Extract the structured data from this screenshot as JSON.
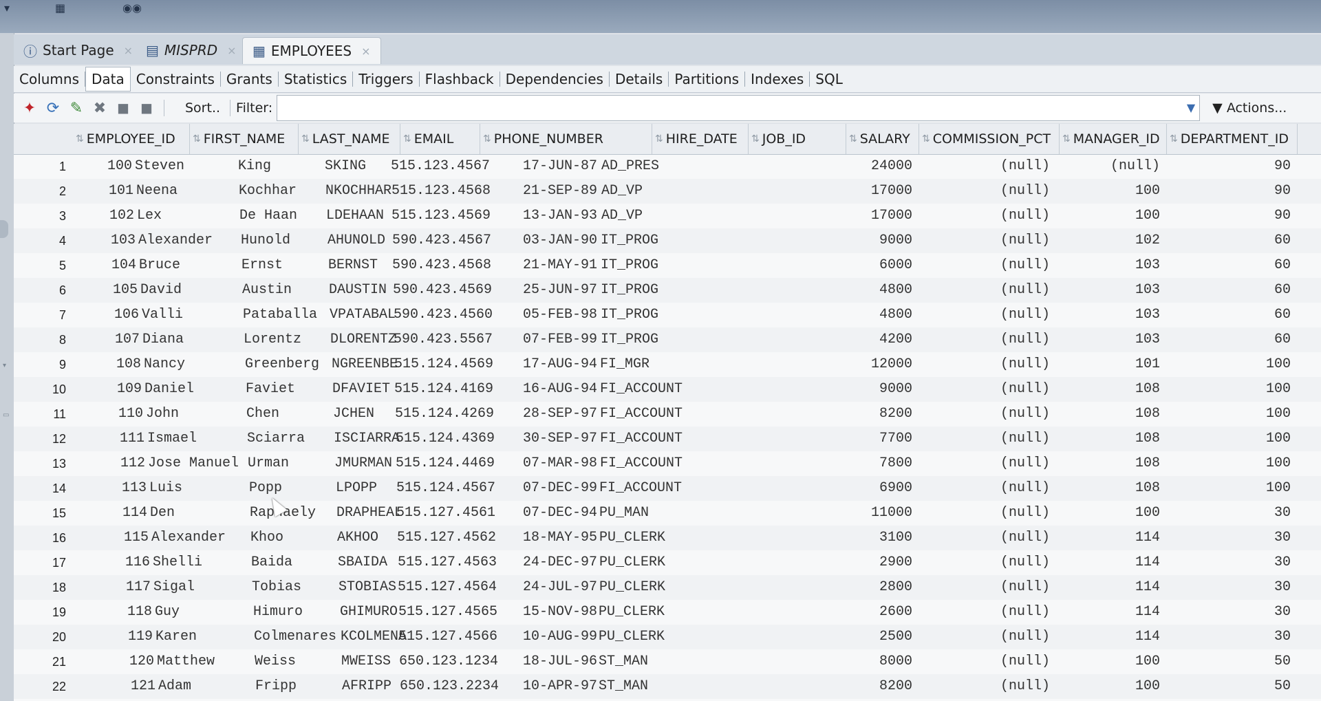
{
  "tabs": [
    {
      "icon": "help-icon",
      "label": "Start Page"
    },
    {
      "icon": "sql-connection-icon",
      "label": "MISPRD"
    },
    {
      "icon": "table-icon",
      "label": "EMPLOYEES"
    }
  ],
  "subtabs": [
    "Columns",
    "Data",
    "Constraints",
    "Grants",
    "Statistics",
    "Triggers",
    "Flashback",
    "Dependencies",
    "Details",
    "Partitions",
    "Indexes",
    "SQL"
  ],
  "toolbar": {
    "sort_label": "Sort..",
    "filter_label": "Filter:",
    "filter_value": "",
    "actions_label": "Actions..."
  },
  "columns": [
    "EMPLOYEE_ID",
    "FIRST_NAME",
    "LAST_NAME",
    "EMAIL",
    "PHONE_NUMBER",
    "HIRE_DATE",
    "JOB_ID",
    "SALARY",
    "COMMISSION_PCT",
    "MANAGER_ID",
    "DEPARTMENT_ID"
  ],
  "rows": [
    [
      "1",
      "100",
      "Steven",
      "King",
      "SKING",
      "515.123.4567",
      "17-JUN-87",
      "AD_PRES",
      "24000",
      "(null)",
      "(null)",
      "90"
    ],
    [
      "2",
      "101",
      "Neena",
      "Kochhar",
      "NKOCHHAR",
      "515.123.4568",
      "21-SEP-89",
      "AD_VP",
      "17000",
      "(null)",
      "100",
      "90"
    ],
    [
      "3",
      "102",
      "Lex",
      "De Haan",
      "LDEHAAN",
      "515.123.4569",
      "13-JAN-93",
      "AD_VP",
      "17000",
      "(null)",
      "100",
      "90"
    ],
    [
      "4",
      "103",
      "Alexander",
      "Hunold",
      "AHUNOLD",
      "590.423.4567",
      "03-JAN-90",
      "IT_PROG",
      "9000",
      "(null)",
      "102",
      "60"
    ],
    [
      "5",
      "104",
      "Bruce",
      "Ernst",
      "BERNST",
      "590.423.4568",
      "21-MAY-91",
      "IT_PROG",
      "6000",
      "(null)",
      "103",
      "60"
    ],
    [
      "6",
      "105",
      "David",
      "Austin",
      "DAUSTIN",
      "590.423.4569",
      "25-JUN-97",
      "IT_PROG",
      "4800",
      "(null)",
      "103",
      "60"
    ],
    [
      "7",
      "106",
      "Valli",
      "Pataballa",
      "VPATABAL",
      "590.423.4560",
      "05-FEB-98",
      "IT_PROG",
      "4800",
      "(null)",
      "103",
      "60"
    ],
    [
      "8",
      "107",
      "Diana",
      "Lorentz",
      "DLORENTZ",
      "590.423.5567",
      "07-FEB-99",
      "IT_PROG",
      "4200",
      "(null)",
      "103",
      "60"
    ],
    [
      "9",
      "108",
      "Nancy",
      "Greenberg",
      "NGREENBE",
      "515.124.4569",
      "17-AUG-94",
      "FI_MGR",
      "12000",
      "(null)",
      "101",
      "100"
    ],
    [
      "10",
      "109",
      "Daniel",
      "Faviet",
      "DFAVIET",
      "515.124.4169",
      "16-AUG-94",
      "FI_ACCOUNT",
      "9000",
      "(null)",
      "108",
      "100"
    ],
    [
      "11",
      "110",
      "John",
      "Chen",
      "JCHEN",
      "515.124.4269",
      "28-SEP-97",
      "FI_ACCOUNT",
      "8200",
      "(null)",
      "108",
      "100"
    ],
    [
      "12",
      "111",
      "Ismael",
      "Sciarra",
      "ISCIARRA",
      "515.124.4369",
      "30-SEP-97",
      "FI_ACCOUNT",
      "7700",
      "(null)",
      "108",
      "100"
    ],
    [
      "13",
      "112",
      "Jose Manuel",
      "Urman",
      "JMURMAN",
      "515.124.4469",
      "07-MAR-98",
      "FI_ACCOUNT",
      "7800",
      "(null)",
      "108",
      "100"
    ],
    [
      "14",
      "113",
      "Luis",
      "Popp",
      "LPOPP",
      "515.124.4567",
      "07-DEC-99",
      "FI_ACCOUNT",
      "6900",
      "(null)",
      "108",
      "100"
    ],
    [
      "15",
      "114",
      "Den",
      "Raphaely",
      "DRAPHEAL",
      "515.127.4561",
      "07-DEC-94",
      "PU_MAN",
      "11000",
      "(null)",
      "100",
      "30"
    ],
    [
      "16",
      "115",
      "Alexander",
      "Khoo",
      "AKHOO",
      "515.127.4562",
      "18-MAY-95",
      "PU_CLERK",
      "3100",
      "(null)",
      "114",
      "30"
    ],
    [
      "17",
      "116",
      "Shelli",
      "Baida",
      "SBAIDA",
      "515.127.4563",
      "24-DEC-97",
      "PU_CLERK",
      "2900",
      "(null)",
      "114",
      "30"
    ],
    [
      "18",
      "117",
      "Sigal",
      "Tobias",
      "STOBIAS",
      "515.127.4564",
      "24-JUL-97",
      "PU_CLERK",
      "2800",
      "(null)",
      "114",
      "30"
    ],
    [
      "19",
      "118",
      "Guy",
      "Himuro",
      "GHIMURO",
      "515.127.4565",
      "15-NOV-98",
      "PU_CLERK",
      "2600",
      "(null)",
      "114",
      "30"
    ],
    [
      "20",
      "119",
      "Karen",
      "Colmenares",
      "KCOLMENA",
      "515.127.4566",
      "10-AUG-99",
      "PU_CLERK",
      "2500",
      "(null)",
      "114",
      "30"
    ],
    [
      "21",
      "120",
      "Matthew",
      "Weiss",
      "MWEISS",
      "650.123.1234",
      "18-JUL-96",
      "ST_MAN",
      "8000",
      "(null)",
      "100",
      "50"
    ],
    [
      "22",
      "121",
      "Adam",
      "Fripp",
      "AFRIPP",
      "650.123.2234",
      "10-APR-97",
      "ST_MAN",
      "8200",
      "(null)",
      "100",
      "50"
    ]
  ]
}
